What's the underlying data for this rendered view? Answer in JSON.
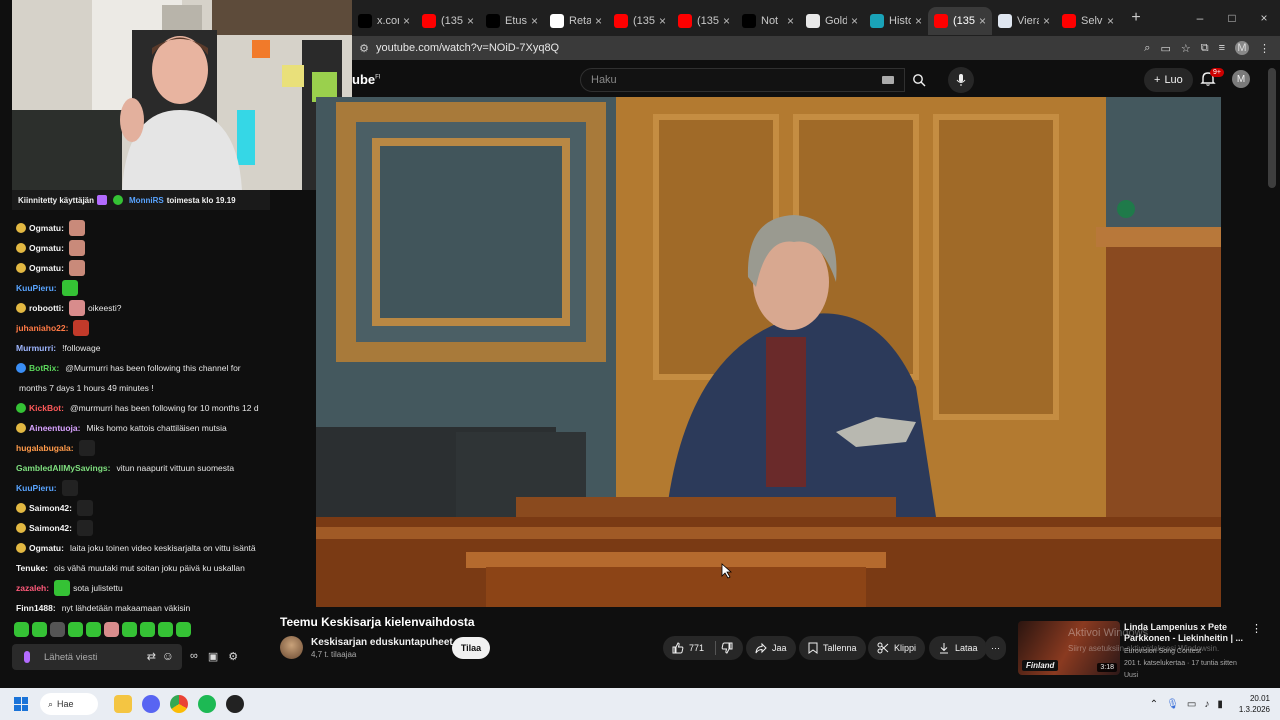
{
  "browser": {
    "tabs": [
      {
        "label": "x.com",
        "fav": "x-icon",
        "color": "#000000",
        "active": false
      },
      {
        "label": "(135)",
        "fav": "youtube-icon",
        "color": "#ff0000",
        "active": false
      },
      {
        "label": "Etusi",
        "fav": "x-icon",
        "color": "#000000",
        "active": false
      },
      {
        "label": "Retai",
        "fav": "google-icon",
        "color": "#ffffff",
        "active": false
      },
      {
        "label": "(135)",
        "fav": "youtube-icon",
        "color": "#ff0000",
        "active": false
      },
      {
        "label": "(135)",
        "fav": "youtube-icon",
        "color": "#ff0000",
        "active": false
      },
      {
        "label": "Not",
        "fav": "x-icon",
        "color": "#000000",
        "active": false
      },
      {
        "label": "Gold",
        "fav": "bank-icon",
        "color": "#e8e8e8",
        "active": false
      },
      {
        "label": "Histo",
        "fav": "chart-icon",
        "color": "#1aa3b8",
        "active": false
      },
      {
        "label": "(135)",
        "fav": "youtube-icon",
        "color": "#ff0000",
        "active": true
      },
      {
        "label": "Viera",
        "fav": "doc-icon",
        "color": "#dfe6f0",
        "active": false
      },
      {
        "label": "Selvi",
        "fav": "youtube-icon",
        "color": "#ff0000",
        "active": false
      }
    ],
    "new_tab": "+",
    "url": "youtube.com/watch?v=NOiD-7Xyq8Q"
  },
  "youtube": {
    "logo_suffix": "FI",
    "search_placeholder": "Haku",
    "create_label": "Luo",
    "notif_count": "9+",
    "avatar_letter": "M",
    "video_title": "Teemu Keskisarja kielenvaihdosta",
    "channel_name": "Keskisarjan eduskuntapuheet",
    "channel_subs": "4,7 t. tilaajaa",
    "subscribe_label": "Tilaa",
    "like_count": "771",
    "share_label": "Jaa",
    "save_label": "Tallenna",
    "clip_label": "Klippi",
    "download_label": "Lataa",
    "rec": {
      "title": "Linda Lampenius x Pete Parkkonen - Liekinheitin | ...",
      "meta_line1": "Eurovision Song Contest",
      "meta_line2": "201 t. katselukertaa · 17 tuntia sitten",
      "meta_line3": "Uusi",
      "duration": "3:18",
      "badge": "Finland"
    },
    "watermark_line1": "Aktivoi Windows",
    "watermark_line2": "Siirry asetuksiin aktivoidaksesi Windowsin."
  },
  "stream": {
    "pinned_prefix": "Kiinnitetty käyttäjän",
    "pinned_user": "MonniRS",
    "pinned_suffix": "toimesta klo 19.19",
    "messages": [
      {
        "user": "Ogmatu:",
        "color": "#f5f5f5",
        "text": "",
        "badge": "#e2b842",
        "emote": "#c98a7a"
      },
      {
        "user": "Ogmatu:",
        "color": "#f5f5f5",
        "text": "",
        "badge": "#e2b842",
        "emote": "#c98a7a"
      },
      {
        "user": "Ogmatu:",
        "color": "#f5f5f5",
        "text": "",
        "badge": "#e2b842",
        "emote": "#c98a7a"
      },
      {
        "user": "KuuPieru:",
        "color": "#59a4ff",
        "text": "",
        "badge": "",
        "emote": "#35c235"
      },
      {
        "user": "robootti:",
        "color": "#f5f5f5",
        "text": "oikeesti?",
        "badge": "#e2b842",
        "emote": "#d88c8c"
      },
      {
        "user": "juhaniaho22:",
        "color": "#ff7a45",
        "text": "",
        "badge": "",
        "emote": "#c23a2a"
      },
      {
        "user": "Murmurri:",
        "color": "#9fb7ff",
        "text": "!followage",
        "badge": "",
        "emote": ""
      },
      {
        "user": "BotRix:",
        "color": "#5bd65b",
        "text": "@Murmurri has been following this channel for",
        "badge": "#3a8ef5",
        "emote": ""
      },
      {
        "user": "",
        "color": "#f5f5f5",
        "text": "months 7 days 1 hours 49 minutes !",
        "badge": "",
        "emote": ""
      },
      {
        "user": "KickBot:",
        "color": "#ff5a5a",
        "text": "@murmurri has been following for 10 months 12 d",
        "badge": "#35c235",
        "emote": ""
      },
      {
        "user": "Aineentuoja:",
        "color": "#d8a2ff",
        "text": "Miks homo kattois chattiläisen mutsia",
        "badge": "#e2b842",
        "emote": ""
      },
      {
        "user": "hugalabugala:",
        "color": "#ff9a4a",
        "text": "",
        "badge": "",
        "emote": "#222222"
      },
      {
        "user": "GambledAllMySavings:",
        "color": "#7fe07f",
        "text": "vitun naapurit vittuun suomesta",
        "badge": "",
        "emote": ""
      },
      {
        "user": "KuuPieru:",
        "color": "#59a4ff",
        "text": "",
        "badge": "",
        "emote": "#222222"
      },
      {
        "user": "Saimon42:",
        "color": "#f5f5f5",
        "text": "",
        "badge": "#e2b842",
        "emote": "#222222"
      },
      {
        "user": "Saimon42:",
        "color": "#f5f5f5",
        "text": "",
        "badge": "#e2b842",
        "emote": "#222222"
      },
      {
        "user": "Ogmatu:",
        "color": "#f5f5f5",
        "text": "laita joku toinen video keskisarjalta on vittu isäntä",
        "badge": "#e2b842",
        "emote": ""
      },
      {
        "user": "Tenuke:",
        "color": "#f5f5f5",
        "text": "ois vähä muutaki mut soitan joku päivä ku uskallan",
        "badge": "",
        "emote": ""
      },
      {
        "user": "zazaleh:",
        "color": "#ff5a7a",
        "text": "sota julistettu",
        "badge": "",
        "emote": "#35c235"
      },
      {
        "user": "Finn1488:",
        "color": "#f5f5f5",
        "text": "nyt lähdetään makaamaan väkisin",
        "badge": "",
        "emote": ""
      }
    ],
    "input_placeholder": "Lähetä viesti"
  },
  "taskbar": {
    "search_label": "Hae",
    "time": "20.01",
    "date": "1.3.2026"
  }
}
